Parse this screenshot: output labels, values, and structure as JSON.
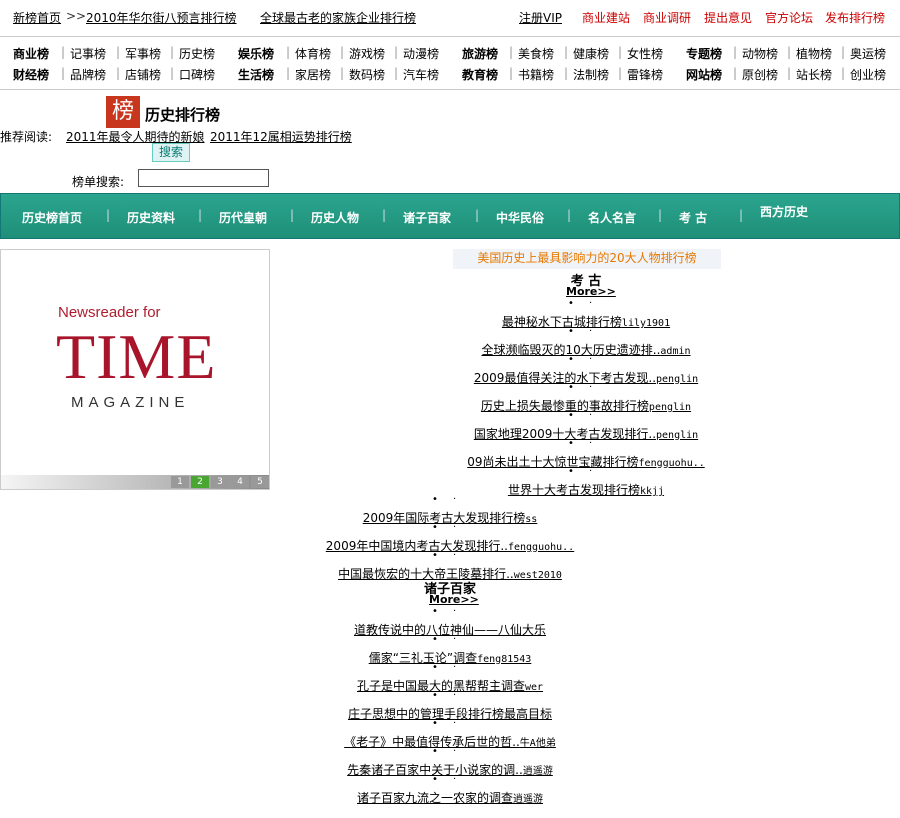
{
  "topbar": {
    "home": "新榜首页",
    "sep": ">>",
    "news1": "2010年华尔街八预言排行榜",
    "news2": "全球最古老的家族企业排行榜",
    "register": "注册VIP",
    "links": [
      "商业建站",
      "商业调研",
      "提出意见",
      "官方论坛",
      "发布排行榜"
    ]
  },
  "categories": {
    "row1": [
      "商业榜",
      "记事榜",
      "军事榜",
      "历史榜",
      "娱乐榜",
      "体育榜",
      "游戏榜",
      "动漫榜",
      "旅游榜",
      "美食榜",
      "健康榜",
      "女性榜",
      "专题榜",
      "动物榜",
      "植物榜",
      "奥运榜"
    ],
    "row2": [
      "财经榜",
      "品牌榜",
      "店铺榜",
      "口碑榜",
      "生活榜",
      "家居榜",
      "数码榜",
      "汽车榜",
      "教育榜",
      "书籍榜",
      "法制榜",
      "雷锋榜",
      "网站榜",
      "原创榜",
      "站长榜",
      "创业榜"
    ]
  },
  "logo": {
    "glyph": "榜",
    "title": "历史排行榜"
  },
  "recommend": {
    "label": "推荐阅读:",
    "items": [
      "2011年最令人期待的新娘",
      "2011年12属相运势排行榜"
    ]
  },
  "search": {
    "button": "搜索",
    "label": "榜单搜索:",
    "value": ""
  },
  "nav": [
    "历史榜首页",
    "历史资料",
    "历代皇朝",
    "历史人物",
    "诸子百家",
    "中华民俗",
    "名人名言",
    "考 古",
    "西方历史"
  ],
  "banner": {
    "line1": "Newsreader for",
    "line2": "TIME",
    "line3": "MAGAZINE",
    "pages": [
      "1",
      "2",
      "3",
      "4",
      "5"
    ],
    "active_page": 2
  },
  "headline": "美国历史上最具影响力的20大人物排行榜",
  "archaeology": {
    "title": "考 古",
    "more": "More>>",
    "items": [
      {
        "t": "最神秘水下古城排行榜",
        "a": "lily1901"
      },
      {
        "t": "全球濒临毁灭的10大历史遗迹排..",
        "a": "admin"
      },
      {
        "t": "2009最值得关注的水下考古发现..",
        "a": "penglin"
      },
      {
        "t": "历史上损失最惨重的事故排行榜",
        "a": "penglin"
      },
      {
        "t": "国家地理2009十大考古发现排行..",
        "a": "penglin"
      },
      {
        "t": "09尚未出土十大惊世宝藏排行榜",
        "a": "fengguohu.."
      },
      {
        "t": "世界十大考古发现排行榜",
        "a": "kkjj"
      },
      {
        "t": "2009年国际考古大发现排行榜",
        "a": "ss"
      },
      {
        "t": "2009年中国境内考古大发现排行..",
        "a": "fengguohu.."
      },
      {
        "t": "中国最恢宏的十大帝王陵墓排行..",
        "a": "west2010"
      }
    ]
  },
  "philosophers": {
    "title": "诸子百家",
    "more": "More>>",
    "items": [
      {
        "t": "道教传说中的八位神仙——八仙大乐",
        "a": ""
      },
      {
        "t": "儒家“三礼玉论”调查",
        "a": "feng81543"
      },
      {
        "t": "孔子是中国最大的黑帮帮主调查",
        "a": "wer"
      },
      {
        "t": "庄子思想中的管理手段排行榜最高目标",
        "a": ""
      },
      {
        "t": "《老子》中最值得传承后世的哲..",
        "a": "牛A他弟"
      },
      {
        "t": "先秦诸子百家中关于小说家的调..",
        "a": "逍遥游"
      },
      {
        "t": "诸子百家九流之一农家的调查",
        "a": "逍遥游"
      }
    ]
  }
}
